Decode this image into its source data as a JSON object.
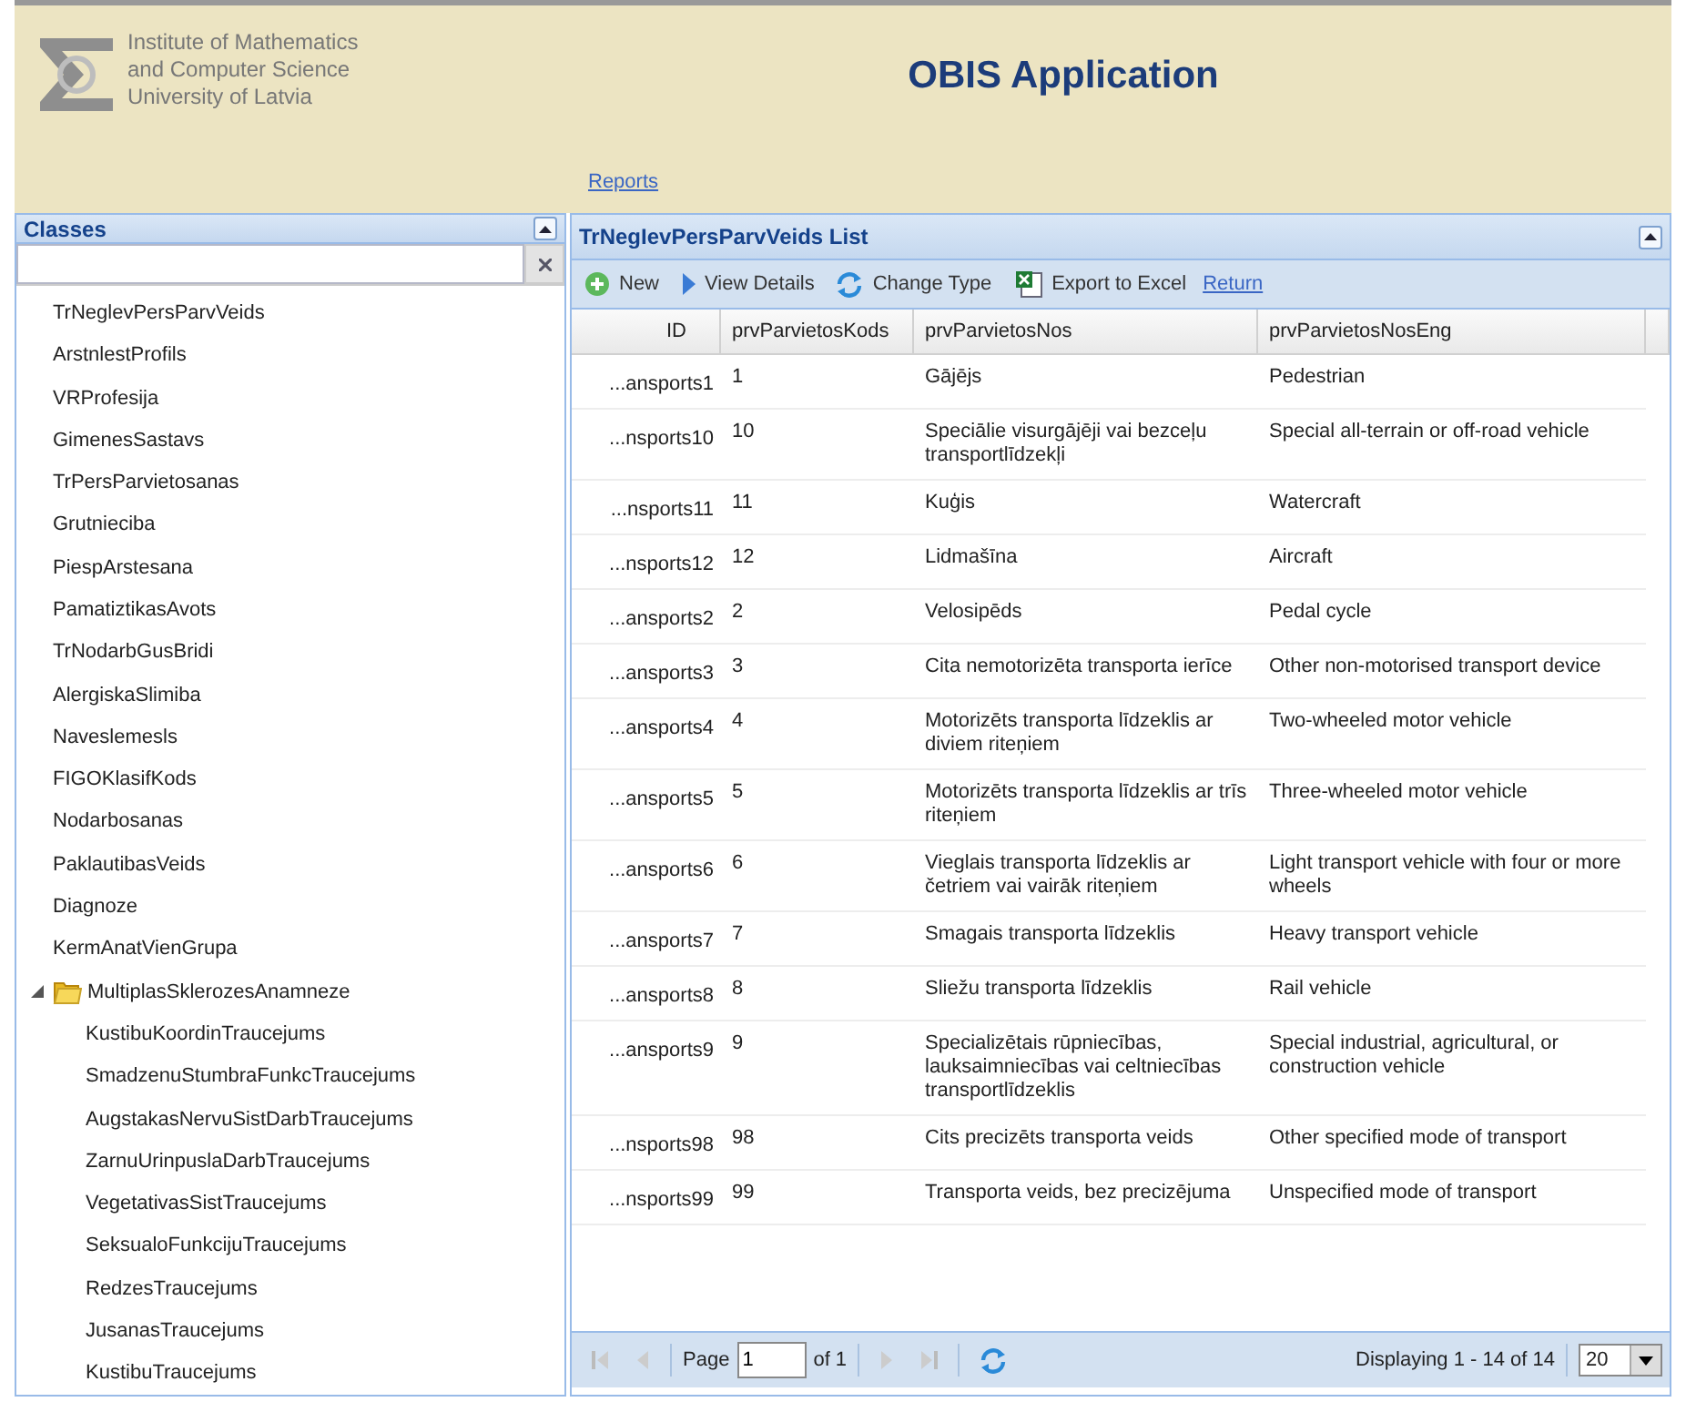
{
  "header": {
    "institute_lines": [
      "Institute of Mathematics",
      "and Computer Science",
      "University of Latvia"
    ],
    "app_title": "OBIS Application",
    "nav_link": "Reports"
  },
  "sidebar": {
    "title": "Classes",
    "items": [
      {
        "label": "TrNeglevPersParvVeids"
      },
      {
        "label": "ArstnlestProfils"
      },
      {
        "label": "VRProfesija"
      },
      {
        "label": "GimenesSastavs"
      },
      {
        "label": "TrPersParvietosanas"
      },
      {
        "label": "Grutnieciba"
      },
      {
        "label": "PiespArstesana"
      },
      {
        "label": "PamatiztikasAvots"
      },
      {
        "label": "TrNodarbGusBridi"
      },
      {
        "label": "AlergiskaSlimiba"
      },
      {
        "label": "Naveslemesls"
      },
      {
        "label": "FIGOKlasifKods"
      },
      {
        "label": "Nodarbosanas"
      },
      {
        "label": "PaklautibasVeids"
      },
      {
        "label": "Diagnoze"
      },
      {
        "label": "KermAnatVienGrupa"
      },
      {
        "label": "MultiplasSklerozesAnamneze",
        "expanded": true,
        "children": [
          {
            "label": "KustibuKoordinTraucejums"
          },
          {
            "label": "SmadzenuStumbraFunkcTraucejums"
          },
          {
            "label": "AugstakasNervuSistDarbTraucejums"
          },
          {
            "label": "ZarnuUrinpuslaDarbTraucejums"
          },
          {
            "label": "VegetativasSistTraucejums"
          },
          {
            "label": "SeksualoFunkcijuTraucejums"
          },
          {
            "label": "RedzesTraucejums"
          },
          {
            "label": "JusanasTraucejums"
          },
          {
            "label": "KustibuTraucejums"
          }
        ]
      }
    ]
  },
  "list": {
    "title": "TrNegIevPersParvVeids List",
    "toolbar": [
      {
        "kind": "new",
        "label": "New"
      },
      {
        "kind": "details",
        "label": "View Details"
      },
      {
        "kind": "change",
        "label": "Change Type"
      },
      {
        "kind": "excel",
        "label": "Export to Excel"
      },
      {
        "kind": "link",
        "label": "Return"
      }
    ],
    "table": {
      "columns": [
        "ID",
        "prvParvietosKods",
        "prvParvietosNos",
        "prvParvietosNosEng"
      ],
      "rows": [
        [
          "...ansports1",
          "1",
          "Gājējs",
          "Pedestrian"
        ],
        [
          "...nsports10",
          "10",
          "Speciālie visurgājēji vai bezceļu transportlīdzekļi",
          "Special all-terrain or off-road vehicle"
        ],
        [
          "...nsports11",
          "11",
          "Kuģis",
          "Watercraft"
        ],
        [
          "...nsports12",
          "12",
          "Lidmašīna",
          "Aircraft"
        ],
        [
          "...ansports2",
          "2",
          "Velosipēds",
          "Pedal cycle"
        ],
        [
          "...ansports3",
          "3",
          "Cita nemotorizēta transporta ierīce",
          "Other non-motorised transport device"
        ],
        [
          "...ansports4",
          "4",
          "Motorizēts transporta līdzeklis ar diviem riteņiem",
          "Two-wheeled motor vehicle"
        ],
        [
          "...ansports5",
          "5",
          "Motorizēts transporta līdzeklis ar trīs riteņiem",
          "Three-wheeled motor vehicle"
        ],
        [
          "...ansports6",
          "6",
          "Vieglais transporta līdzeklis ar četriem vai vairāk riteņiem",
          "Light transport vehicle with four or more wheels"
        ],
        [
          "...ansports7",
          "7",
          "Smagais transporta līdzeklis",
          "Heavy transport vehicle"
        ],
        [
          "...ansports8",
          "8",
          "Sliežu transporta līdzeklis",
          "Rail vehicle"
        ],
        [
          "...ansports9",
          "9",
          "Specializētais rūpniecības, lauksaimniecības vai celtniecības transportlīdzeklis",
          "Special industrial, agricultural, or construction vehicle"
        ],
        [
          "...nsports98",
          "98",
          "Cits precizēts transporta veids",
          "Other specified mode of transport"
        ],
        [
          "...nsports99",
          "99",
          "Transporta veids, bez precizējuma",
          "Unspecified mode of transport"
        ]
      ]
    },
    "pager": {
      "page_label": "Page",
      "page_value": "1",
      "of_label": "of 1",
      "display_text": "Displaying 1 - 14 of 14",
      "page_size": "20"
    }
  }
}
